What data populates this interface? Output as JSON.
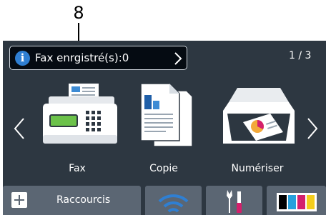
{
  "callout": {
    "number": "8"
  },
  "notification": {
    "text": "Fax enrgistré(s):0"
  },
  "pagination": {
    "indicator": "1 / 3"
  },
  "apps": [
    {
      "label": "Fax",
      "icon": "fax-machine-icon"
    },
    {
      "label": "Copie",
      "icon": "copy-documents-icon"
    },
    {
      "label": "Numériser",
      "icon": "scanner-icon"
    }
  ],
  "bottom_bar": {
    "shortcuts_label": "Raccourcis",
    "icons": [
      "plus-icon",
      "wifi-icon",
      "tools-icon",
      "toner-icon"
    ]
  },
  "colors": {
    "screen_bg": "#2d3741",
    "bar_bg": "#5b6673",
    "info_blue": "#2f7fd2",
    "wifi_blue": "#2f7fd2",
    "toner_black": "#000000",
    "toner_cyan": "#27a0dc",
    "toner_magenta": "#d4206c",
    "toner_yellow": "#f3cd1c"
  }
}
